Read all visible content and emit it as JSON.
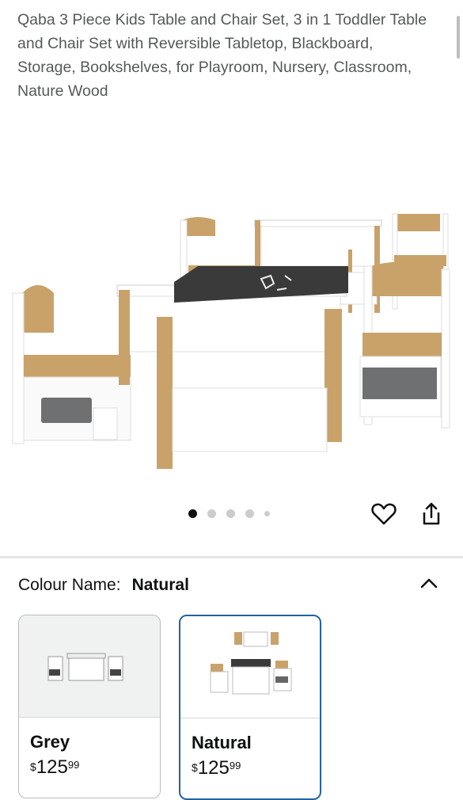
{
  "product": {
    "title": "Qaba 3 Piece Kids Table and Chair Set, 3 in 1 Toddler Table and Chair Set with Reversible Tabletop, Blackboard, Storage, Bookshelves, for Playroom, Nursery, Classroom, Nature Wood"
  },
  "gallery": {
    "image_count": 5,
    "active_index": 0
  },
  "actions": {
    "wishlist_icon": "heart-icon",
    "share_icon": "share-icon"
  },
  "variation": {
    "label": "Colour Name:",
    "selected": "Natural",
    "options": [
      {
        "name": "Grey",
        "currency": "$",
        "whole": "125",
        "fraction": "99"
      },
      {
        "name": "Natural",
        "currency": "$",
        "whole": "125",
        "fraction": "99"
      }
    ]
  },
  "colors": {
    "selected_border": "#2162a1",
    "wood": "#c9a26a",
    "board": "#3a3a3a",
    "bin": "#6f7071"
  }
}
